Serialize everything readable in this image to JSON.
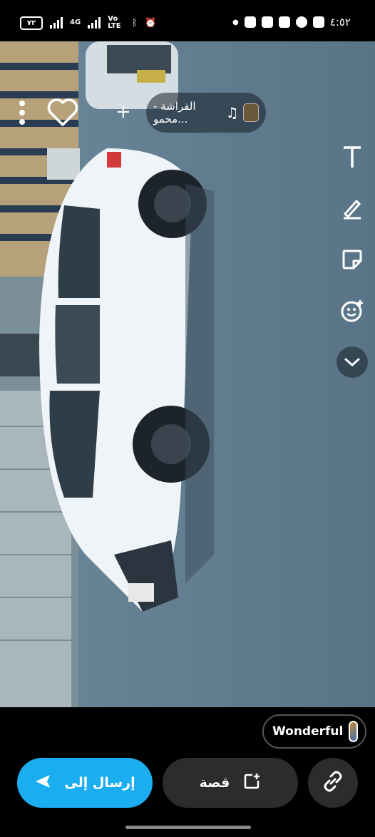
{
  "status_bar": {
    "battery": "٧٢",
    "network_label": "4G",
    "volte_label": "Vo LTE",
    "time": "٤:٥٢"
  },
  "music": {
    "title": "الفراشة - محمو..."
  },
  "bottom": {
    "sound_chip_label": "Wonderful",
    "send_label": "إرسال إلى",
    "story_label": "قصة"
  },
  "icons": {
    "kebab": "more-vertical-icon",
    "heart": "heart-icon",
    "plus": "plus-icon",
    "text": "text-tool-icon",
    "pen": "pen-tool-icon",
    "sticker": "sticker-tool-icon",
    "emoji": "emoji-tool-icon",
    "chevron": "chevron-down-icon",
    "link": "link-icon",
    "send": "send-arrow-icon",
    "add_story": "add-story-icon"
  }
}
